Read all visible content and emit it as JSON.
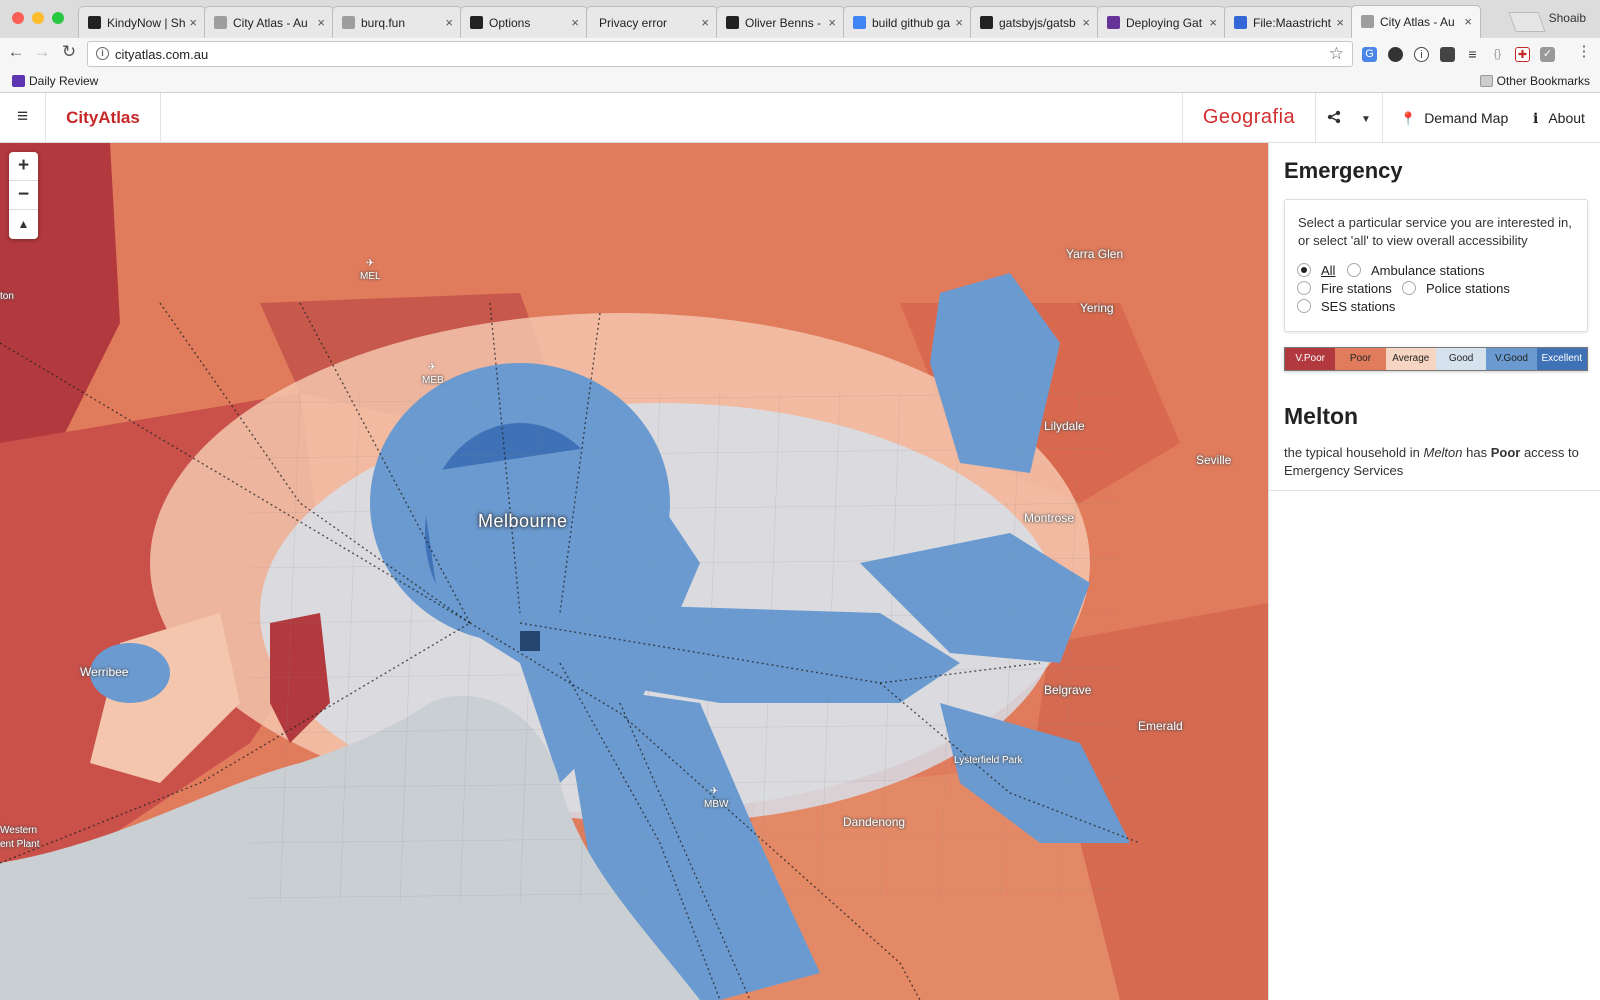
{
  "browser": {
    "tabs": [
      {
        "title": "KindyNow | Sh",
        "favicon_color": "#222222",
        "active": false
      },
      {
        "title": "City Atlas - Au",
        "favicon_color": "#9e9e9e",
        "active": false
      },
      {
        "title": "burq.fun",
        "favicon_color": "#9e9e9e",
        "active": false
      },
      {
        "title": "Options",
        "favicon_color": "#222222",
        "active": false
      },
      {
        "title": "Privacy error",
        "favicon_color": "",
        "active": false
      },
      {
        "title": "Oliver Benns -",
        "favicon_color": "#222222",
        "active": false
      },
      {
        "title": "build github ga",
        "favicon_color": "#4285f4",
        "active": false
      },
      {
        "title": "gatsbyjs/gatsb",
        "favicon_color": "#222222",
        "active": false
      },
      {
        "title": "Deploying Gat",
        "favicon_color": "#663399",
        "active": false
      },
      {
        "title": "File:Maastricht",
        "favicon_color": "#3367d6",
        "active": false
      },
      {
        "title": "City Atlas - Au",
        "favicon_color": "#9e9e9e",
        "active": true
      }
    ],
    "tab_close_glyph": "×",
    "profile_name": "Shoaib",
    "url": "cityatlas.com.au",
    "bookmarks": [
      {
        "label": "Daily Review",
        "icon_color": "#5e35b1"
      }
    ],
    "other_bookmarks": "Other Bookmarks"
  },
  "app": {
    "brand": "CityAtlas",
    "partner": "Geografia",
    "share_icon": "share-icon",
    "nav": [
      {
        "label": "Demand Map",
        "icon": "pin-icon"
      },
      {
        "label": "About",
        "icon": "info-icon"
      }
    ],
    "accent_color": "#c62828"
  },
  "map": {
    "zoom_in": "+",
    "zoom_out": "−",
    "reset_north": "▲",
    "labels": [
      {
        "text": "Melbourne",
        "kind": "city"
      },
      {
        "text": "Yarra Glen",
        "kind": "town"
      },
      {
        "text": "Yering",
        "kind": "town"
      },
      {
        "text": "Lilydale",
        "kind": "town"
      },
      {
        "text": "Seville",
        "kind": "town"
      },
      {
        "text": "Montrose",
        "kind": "town"
      },
      {
        "text": "Belgrave",
        "kind": "town"
      },
      {
        "text": "Emerald",
        "kind": "town"
      },
      {
        "text": "Lysterfield Park",
        "kind": "park"
      },
      {
        "text": "Dandenong",
        "kind": "town"
      },
      {
        "text": "Werribee",
        "kind": "town"
      },
      {
        "text": "MEL",
        "kind": "airport"
      },
      {
        "text": "MEB",
        "kind": "airport"
      },
      {
        "text": "MBW",
        "kind": "airport"
      },
      {
        "text": "Western",
        "kind": "partial"
      },
      {
        "text": "ent Plant",
        "kind": "partial"
      },
      {
        "text": "ton",
        "kind": "partial"
      }
    ],
    "colors": {
      "v_poor": "#b2393e",
      "poor": "#e07b5c",
      "average": "#f3c6ad",
      "good": "#d6e3ef",
      "v_good": "#6a9ad0",
      "excellent": "#3f71b6",
      "water": "#c9cfd2"
    }
  },
  "panel": {
    "title": "Emergency",
    "description": "Select a particular service you are interested in, or select 'all' to view overall accessibility",
    "services": [
      {
        "label": "All",
        "selected": true
      },
      {
        "label": "Ambulance stations",
        "selected": false
      },
      {
        "label": "Fire stations",
        "selected": false
      },
      {
        "label": "Police stations",
        "selected": false
      },
      {
        "label": "SES stations",
        "selected": false
      }
    ],
    "legend": [
      {
        "label": "V.Poor",
        "color": "#b2393e"
      },
      {
        "label": "Poor",
        "color": "#e07b5c"
      },
      {
        "label": "Average",
        "color": "#f6d6c2"
      },
      {
        "label": "Good",
        "color": "#d6e3ef"
      },
      {
        "label": "V.Good",
        "color": "#6a9ad0"
      },
      {
        "label": "Excellent",
        "color": "#3f71b6"
      }
    ],
    "region_name": "Melton",
    "summary": {
      "prefix": "the typical household in ",
      "place": "Melton",
      "middle": " has ",
      "rating": "Poor",
      "suffix": " access to Emergency Services"
    }
  }
}
